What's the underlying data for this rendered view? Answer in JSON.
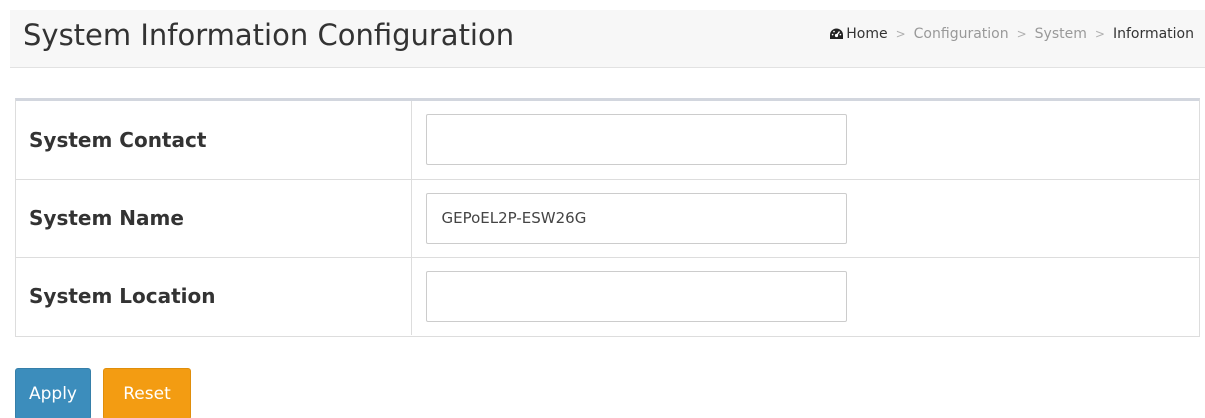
{
  "header": {
    "title": "System Information Configuration"
  },
  "breadcrumb": {
    "items": [
      "Home",
      "Configuration",
      "System",
      "Information"
    ],
    "separator": ">",
    "home_icon": "tachometer-icon"
  },
  "form": {
    "rows": [
      {
        "label": "System Contact",
        "value": "",
        "placeholder": ""
      },
      {
        "label": "System Name",
        "value": "GEPoEL2P-ESW26G",
        "placeholder": ""
      },
      {
        "label": "System Location",
        "value": "",
        "placeholder": ""
      }
    ]
  },
  "actions": {
    "apply_label": "Apply",
    "reset_label": "Reset"
  },
  "colors": {
    "apply": "#3c8dbc",
    "reset": "#f39c12",
    "header_bg": "#f7f7f7"
  }
}
